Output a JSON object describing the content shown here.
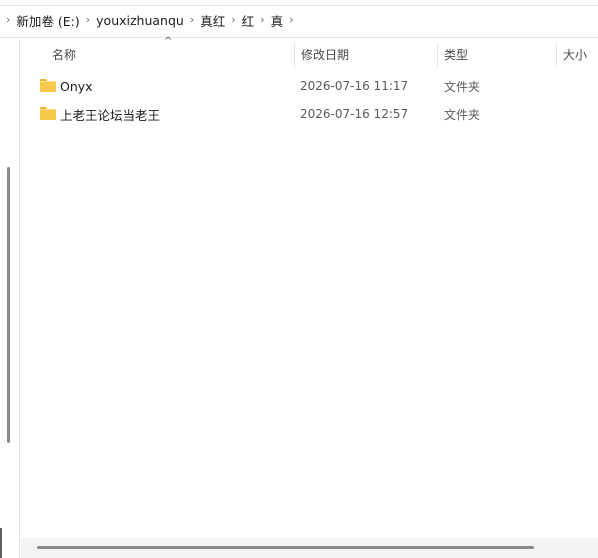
{
  "breadcrumb": {
    "items": [
      "新加卷 (E:)",
      "youxizhuanqu",
      "真红",
      "红",
      "真"
    ]
  },
  "columns": {
    "name": "名称",
    "modified": "修改日期",
    "type": "类型",
    "size": "大小",
    "sort_indicator": "^"
  },
  "files": [
    {
      "name": "Onyx",
      "modified": "2026-07-16 11:17",
      "type": "文件夹",
      "icon": "folder-icon"
    },
    {
      "name": "上老王论坛当老王",
      "modified": "2026-07-16 12:57",
      "type": "文件夹",
      "icon": "folder-icon"
    }
  ],
  "colors": {
    "folder": "#f7c94a",
    "folder_tab": "#e7b432",
    "hover": "#e5f3ff",
    "scroll_thumb": "#8a8a8a"
  }
}
